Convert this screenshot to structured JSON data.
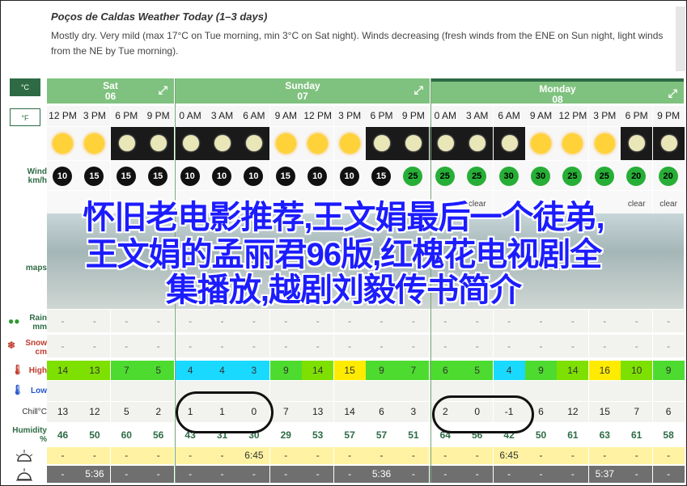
{
  "header": {
    "title": "Poços de Caldas Weather Today (1–3 days)",
    "description": "Mostly dry. Very mild (max 17°C on Tue morning, min 3°C on Sat night). Winds decreasing (fresh winds from the ENE on Sun night, light winds from the NE by Tue morning)."
  },
  "units": {
    "celsius": "°C",
    "fahrenheit": "°F"
  },
  "row_labels": {
    "wind": "Wind",
    "wind_unit": "km/h",
    "maps": "maps",
    "rain": "Rain",
    "rain_unit": "mm",
    "snow": "Snow",
    "snow_unit": "cm",
    "high": "High",
    "low": "Low",
    "chill": "Chill°C",
    "humidity": "Humidity",
    "humidity_unit": "%"
  },
  "days": [
    {
      "name": "Sat",
      "date": "06"
    },
    {
      "name": "Sunday",
      "date": "07"
    },
    {
      "name": "Monday",
      "date": "08"
    }
  ],
  "columns": [
    {
      "time": "12 PM",
      "sky": "day",
      "wind": "10",
      "sky_text": "",
      "high": "14",
      "low": "",
      "chill": "13",
      "humidity": "46",
      "high_color": "#7ee000"
    },
    {
      "time": "3 PM",
      "sky": "day",
      "wind": "15",
      "sky_text": "",
      "high": "13",
      "low": "",
      "chill": "12",
      "humidity": "50",
      "high_color": "#7ee000"
    },
    {
      "time": "6 PM",
      "sky": "night",
      "wind": "15",
      "sky_text": "",
      "high": "7",
      "low": "",
      "chill": "5",
      "humidity": "60",
      "high_color": "#4ddb2f"
    },
    {
      "time": "9 PM",
      "sky": "night",
      "wind": "15",
      "sky_text": "",
      "high": "5",
      "low": "",
      "chill": "2",
      "humidity": "56",
      "high_color": "#4ddb2f"
    },
    {
      "time": "0 AM",
      "sky": "night",
      "wind": "10",
      "sky_text": "",
      "high": "4",
      "low": "",
      "chill": "1",
      "humidity": "43",
      "high_color": "#19d9ff"
    },
    {
      "time": "3 AM",
      "sky": "night",
      "wind": "10",
      "sky_text": "",
      "high": "4",
      "low": "",
      "chill": "1",
      "humidity": "31",
      "high_color": "#19d9ff"
    },
    {
      "time": "6 AM",
      "sky": "night",
      "wind": "10",
      "sky_text": "",
      "high": "3",
      "low": "",
      "chill": "0",
      "humidity": "30",
      "high_color": "#19d9ff"
    },
    {
      "time": "9 AM",
      "sky": "day",
      "wind": "15",
      "sky_text": "",
      "high": "9",
      "low": "",
      "chill": "7",
      "humidity": "29",
      "high_color": "#4ddb2f"
    },
    {
      "time": "12 PM",
      "sky": "day",
      "wind": "10",
      "sky_text": "",
      "high": "14",
      "low": "",
      "chill": "13",
      "humidity": "53",
      "high_color": "#7ee000"
    },
    {
      "time": "3 PM",
      "sky": "day",
      "wind": "10",
      "sky_text": "",
      "high": "15",
      "low": "",
      "chill": "14",
      "humidity": "57",
      "high_color": "#ffeb00"
    },
    {
      "time": "6 PM",
      "sky": "night",
      "wind": "15",
      "sky_text": "",
      "high": "9",
      "low": "",
      "chill": "6",
      "humidity": "57",
      "high_color": "#4ddb2f"
    },
    {
      "time": "9 PM",
      "sky": "night",
      "wind": "25",
      "sky_text": "",
      "high": "7",
      "low": "",
      "chill": "3",
      "humidity": "51",
      "high_color": "#4ddb2f"
    },
    {
      "time": "0 AM",
      "sky": "night",
      "wind": "25",
      "sky_text": "",
      "high": "6",
      "low": "",
      "chill": "2",
      "humidity": "64",
      "high_color": "#4ddb2f"
    },
    {
      "time": "3 AM",
      "sky": "night",
      "wind": "25",
      "sky_text": "clear",
      "high": "5",
      "low": "",
      "chill": "0",
      "humidity": "56",
      "high_color": "#4ddb2f"
    },
    {
      "time": "6 AM",
      "sky": "night",
      "wind": "30",
      "sky_text": "",
      "high": "4",
      "low": "",
      "chill": "-1",
      "humidity": "42",
      "high_color": "#19d9ff"
    },
    {
      "time": "9 AM",
      "sky": "day",
      "wind": "30",
      "sky_text": "",
      "high": "9",
      "low": "",
      "chill": "6",
      "humidity": "50",
      "high_color": "#4ddb2f"
    },
    {
      "time": "12 PM",
      "sky": "day",
      "wind": "25",
      "sky_text": "",
      "high": "14",
      "low": "",
      "chill": "12",
      "humidity": "61",
      "high_color": "#7ee000"
    },
    {
      "time": "3 PM",
      "sky": "day",
      "wind": "25",
      "sky_text": "",
      "high": "16",
      "low": "",
      "chill": "15",
      "humidity": "63",
      "high_color": "#ffeb00"
    },
    {
      "time": "6 PM",
      "sky": "night",
      "wind": "20",
      "sky_text": "clear",
      "high": "10",
      "low": "",
      "chill": "7",
      "humidity": "61",
      "high_color": "#7ee000"
    },
    {
      "time": "9 PM",
      "sky": "night",
      "wind": "20",
      "sky_text": "clear",
      "high": "9",
      "low": "",
      "chill": "6",
      "humidity": "58",
      "high_color": "#4ddb2f"
    }
  ],
  "sunrise": [
    "-",
    "-",
    "-",
    "-",
    "-",
    "-",
    "6:45",
    "-",
    "-",
    "-",
    "-",
    "-",
    "-",
    "-",
    "6:45",
    "-",
    "-",
    "-",
    "-",
    "-"
  ],
  "sunset": [
    "-",
    "5:36",
    "-",
    "-",
    "-",
    "-",
    "-",
    "-",
    "-",
    "-",
    "5:36",
    "-",
    "-",
    "-",
    "-",
    "-",
    "-",
    "5:37",
    "-",
    "-"
  ],
  "empty_mark": "-",
  "overlay_text": {
    "line1": "怀旧老电影推荐,王文娟最后一个徒弟,",
    "line2": "王文娟的孟丽君96版,红槐花电视剧全",
    "line3": "集播放,越剧刘毅传书简介"
  },
  "colors": {
    "accent": "#2e6b45",
    "day_bar": "#7fc27f"
  }
}
